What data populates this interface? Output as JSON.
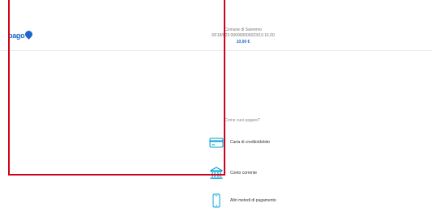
{
  "header": {
    "logo_text": "pago",
    "merchant_name": "Comune di Sanremo",
    "payment_code": "RF18/023 000000000023/19 16.00",
    "amount": "10,00 €"
  },
  "main": {
    "question": "Come vuoi pagare?",
    "methods": [
      {
        "label": "Carta di credito/debito",
        "icon": "credit-card-icon"
      },
      {
        "label": "Conto corrente",
        "icon": "bank-icon"
      },
      {
        "label": "Altri metodi di pagamento",
        "icon": "smartphone-icon"
      }
    ]
  },
  "colors": {
    "accent": "#1a66cc",
    "icon": "#00a3d7",
    "frame": "#d0021b"
  }
}
